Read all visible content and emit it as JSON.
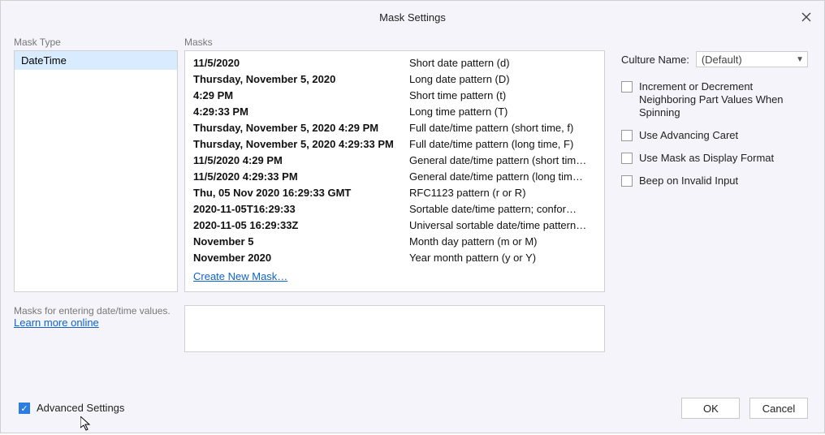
{
  "dialog": {
    "title": "Mask Settings"
  },
  "columns": {
    "mask_type_label": "Mask Type",
    "masks_label": "Masks"
  },
  "mask_types": {
    "items": [
      {
        "label": "DateTime"
      }
    ]
  },
  "masks": {
    "items": [
      {
        "sample": "11/5/2020",
        "desc": "Short date pattern (d)"
      },
      {
        "sample": "Thursday, November 5, 2020",
        "desc": "Long date pattern (D)"
      },
      {
        "sample": "4:29 PM",
        "desc": "Short time pattern (t)"
      },
      {
        "sample": "4:29:33 PM",
        "desc": "Long time pattern (T)"
      },
      {
        "sample": "Thursday, November 5, 2020 4:29 PM",
        "desc": "Full date/time pattern (short time, f)"
      },
      {
        "sample": "Thursday, November 5, 2020 4:29:33 PM",
        "desc": "Full date/time pattern (long time, F)"
      },
      {
        "sample": "11/5/2020 4:29 PM",
        "desc": "General date/time pattern (short tim…"
      },
      {
        "sample": "11/5/2020 4:29:33 PM",
        "desc": "General date/time pattern (long tim…"
      },
      {
        "sample": "Thu, 05 Nov 2020 16:29:33 GMT",
        "desc": "RFC1123 pattern (r or R)"
      },
      {
        "sample": "2020-11-05T16:29:33",
        "desc": "Sortable date/time pattern; confor…"
      },
      {
        "sample": "2020-11-05 16:29:33Z",
        "desc": "Universal sortable date/time pattern…"
      },
      {
        "sample": "November 5",
        "desc": "Month day pattern (m or M)"
      },
      {
        "sample": "November 2020",
        "desc": "Year month pattern (y or Y)"
      }
    ],
    "create_link": "Create New Mask…"
  },
  "help": {
    "text": "Masks for entering date/time values.",
    "link": "Learn more online"
  },
  "culture": {
    "label": "Culture Name:",
    "value": "(Default)"
  },
  "options": {
    "increment_label": "Increment or Decrement Neighboring Part Values When Spinning",
    "advancing_label": "Use Advancing Caret",
    "displayfmt_label": "Use Mask as Display Format",
    "beep_label": "Beep on Invalid Input"
  },
  "footer": {
    "advanced_label": "Advanced Settings",
    "ok_label": "OK",
    "cancel_label": "Cancel"
  }
}
